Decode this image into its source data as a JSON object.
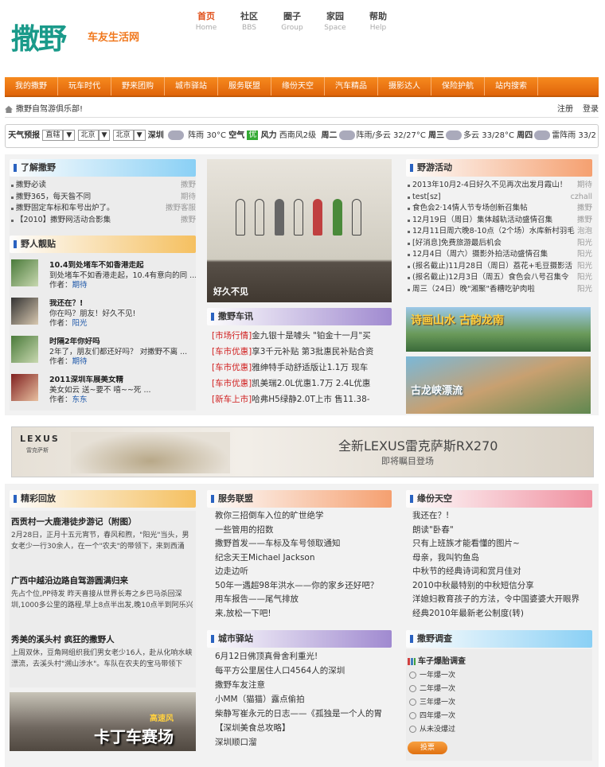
{
  "logo": {
    "main": "撒野",
    "sub": "车友生活网"
  },
  "topnav": [
    {
      "cn": "首页",
      "en": "Home"
    },
    {
      "cn": "社区",
      "en": "BBS"
    },
    {
      "cn": "圈子",
      "en": "Group"
    },
    {
      "cn": "家园",
      "en": "Space"
    },
    {
      "cn": "帮助",
      "en": "Help"
    }
  ],
  "mainnav": [
    "我的撒野",
    "玩车时代",
    "野来团购",
    "城市驿站",
    "服务联盟",
    "缘份天空",
    "汽车精品",
    "摄影达人",
    "保险护航",
    "站内搜索"
  ],
  "crumb": {
    "text": "撒野自驾游俱乐部!",
    "register": "注册",
    "login": "登录"
  },
  "weather": {
    "label": "天气预报",
    "sel1": "直辖",
    "sel2": "北京",
    "sel3": "北京",
    "city": "深圳",
    "w1": "阵雨 30°C",
    "air": "空气",
    "good": "优",
    "wind": "风力",
    "wind_v": "西南风2级",
    "d2": "周二",
    "w2": "阵雨/多云 32/27°C",
    "d3": "周三",
    "w3": "多云 33/28°C",
    "d4": "周四",
    "w4": "雷阵雨 33/2"
  },
  "about": {
    "title": "了解撒野",
    "items": [
      {
        "t": "撒野必读",
        "r": "撒野"
      },
      {
        "t": "撒野365，每天昝不同",
        "r": "期待"
      },
      {
        "t": "撒野固定车标和车号出炉了。",
        "r": "撒野客服"
      },
      {
        "t": "【2010】撒野网活动合影集",
        "r": "撒野"
      }
    ]
  },
  "posts": {
    "title": "野人靓贴",
    "items": [
      {
        "t": "10.4到处堵车不如香港走起",
        "d": "到处堵车不如香港走起，10.4有意向的同 ...",
        "a": "期待"
      },
      {
        "t": "我还在？!",
        "d": "你在吗？朋友！好久不见!",
        "a": "阳光"
      },
      {
        "t": "时隔2年你好吗",
        "d": "2年了，朋友们都还好吗？ 对撒野不离 ...",
        "a": "期待"
      },
      {
        "t": "2011深圳车展美女精",
        "d": "美女如云 送~要不 嘻~~死 ...",
        "a": "东东"
      }
    ],
    "author_label": "作者："
  },
  "photo_caption": "好久不见",
  "carnews": {
    "title": "撒野车讯",
    "items": [
      {
        "tag": "[市场行情]",
        "t": "金九银十是噱头 \"铂金十一月\"买"
      },
      {
        "tag": "[车市优惠]",
        "t": "享3千元补贴 第3批惠民补贴合资"
      },
      {
        "tag": "[车市优惠]",
        "t": "雅绅特手动舒适版让1.1万 现车"
      },
      {
        "tag": "[车市优惠]",
        "t": "凯美瑞2.0L优惠1.7万 2.4L优惠"
      },
      {
        "tag": "[新车上市]",
        "t": "哈弗H5绿静2.0T上市 售11.38-"
      }
    ]
  },
  "activity": {
    "title": "野游活动",
    "items": [
      {
        "t": "2013年10月2-4日好久不见再次出发月霞山！",
        "r": "期待"
      },
      {
        "t": "test[sz]",
        "r": "czhall"
      },
      {
        "t": "食色会2·14情人节专场创新召集帖",
        "r": "撒野"
      },
      {
        "t": "12月19日（周日）集体越轨活动盛情召集",
        "r": "撒野"
      },
      {
        "t": "12月11日周六晚8-10点（2个场）水库新村羽毛",
        "r": "泡泡"
      },
      {
        "t": "[好消息]免费旅游最后机会",
        "r": "阳光"
      },
      {
        "t": "12月4日（周六）摄影外拍活动盛情召集",
        "r": "阳光"
      },
      {
        "t": "(报名截止)11月28日（周日）荔花+毛豆摄影活",
        "r": "阳光"
      },
      {
        "t": "(报名截止)12月3日（周五）食色会八号召集令",
        "r": "阳光"
      },
      {
        "t": "周三（24日）晚\"湘聚\"香糟吃驴肉啦",
        "r": "阳光"
      }
    ]
  },
  "pic1": "诗画山水 古韵龙南",
  "pic2": "古龙峡漂流",
  "banner": {
    "brand": "LEXUS",
    "brand_cn": "雷克萨斯",
    "headline": "全新LEXUS雷克萨斯RX270",
    "sub": "即将瞩目登场"
  },
  "highlights": {
    "title": "精彩回放",
    "articles": [
      {
        "t": "西贡村一大鹿港徒步游记（附图）",
        "d": "2月28日，正月十五元宵节，春风和煦，\"阳光\"当头，男女老少一行30余人，在一个\"农夫\"的带领下，来到西涌"
      },
      {
        "t": "广西中越沿边路自驾游圆满归来",
        "d": "先占个位,PP待发 昨天喜接从世界长寿之乡巴马杀回深圳,1000多公里的路程,早上8点半出发,晚10点半到阿乐兴"
      },
      {
        "t": "秀美的溪头村 疯狂的撒野人",
        "d": "上周双休，豆角网组织我们男女老少16人，赴从化响水峡漂流，去溪头村\"溯山涉水\"。车队在农夫的宝马带领下"
      }
    ],
    "kart": "卡丁车赛场",
    "kart_sub": "高速风"
  },
  "service": {
    "title": "服务联盟",
    "items": [
      "教你三招倒车入位的旷世绝学",
      "一些管用的招数",
      "撒野首发——车标及车号领取通知",
      "纪念天王Michael Jackson",
      "边走边听",
      "50年一遇超98年洪水——你的家乡还好吧？",
      "用车报告——尾气排放",
      "来,放松一下吧!"
    ]
  },
  "city": {
    "title": "城市驿站",
    "items": [
      "6月12日佛顶真骨舍利重光!",
      "每平方公里居住人口4564人的深圳",
      "撒野车友注意",
      "小MM（猫猫）露点偷拍",
      "柴静写崔永元的日志——《孤独是一个人的胃",
      "【深圳美食总攻略】",
      "深圳顺口溜"
    ]
  },
  "fate": {
    "title": "缘份天空",
    "items": [
      "我还在？!",
      "朗读\"卧春\"",
      "只有上班族才能看懂的图片~",
      "母亲，我叫钓鱼岛",
      "中秋节的经典诗词和赏月佳对",
      "2010中秋最特别的中秋短信分享",
      "洋媳妇教育孩子的方法，令中国婆婆大开眼界",
      "经典2010年最新老公制度(转)"
    ]
  },
  "survey": {
    "title": "撒野调查",
    "question": "车子爆胎调查",
    "options": [
      "一年爆一次",
      "二年爆一次",
      "三年爆一次",
      "四年爆一次",
      "从未没爆过"
    ],
    "submit": "投票"
  }
}
